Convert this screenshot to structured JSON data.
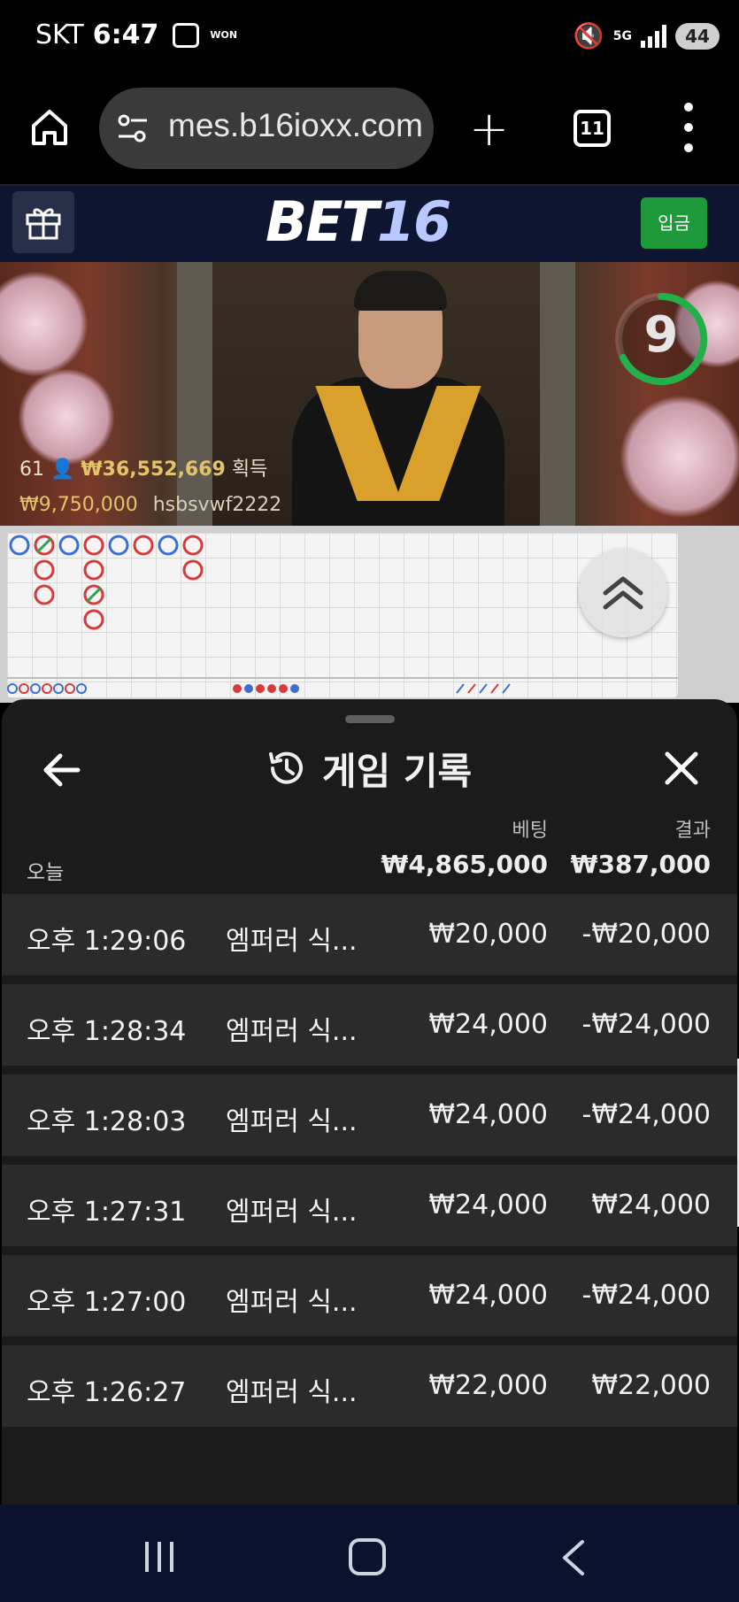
{
  "status_bar": {
    "carrier": "SKT",
    "time": "6:47",
    "won_label": "WON",
    "network": "5G",
    "battery": "44"
  },
  "browser": {
    "url": "mes.b16ioxx.com",
    "tab_count": "11"
  },
  "site": {
    "logo_part1": "BET",
    "logo_part2": "16",
    "deposit_label": "입금"
  },
  "video": {
    "countdown": "9",
    "players": "61",
    "total_win": "₩36,552,669",
    "total_win_suffix": "획득",
    "recent_win_amount": "₩9,750,000",
    "recent_win_user": "hsbsvwf2222"
  },
  "predictions": [
    {
      "label": "P",
      "color": "#3b6fd1"
    },
    {
      "label": "B",
      "color": "#d63a3a"
    },
    {
      "label": "T",
      "color": "#2e9e4f"
    },
    {
      "label": "B",
      "color": "#d63a3a"
    }
  ],
  "history": {
    "title": "게임 기록",
    "col_bet": "베팅",
    "col_result": "결과",
    "summary_label": "오늘",
    "summary_bet": "₩4,865,000",
    "summary_result": "₩387,000",
    "rows": [
      {
        "time": "오후 1:29:06",
        "game": "엠퍼러 식...",
        "bet": "₩20,000",
        "result": "-₩20,000"
      },
      {
        "time": "오후 1:28:34",
        "game": "엠퍼러 식...",
        "bet": "₩24,000",
        "result": "-₩24,000"
      },
      {
        "time": "오후 1:28:03",
        "game": "엠퍼러 식...",
        "bet": "₩24,000",
        "result": "-₩24,000"
      },
      {
        "time": "오후 1:27:31",
        "game": "엠퍼러 식...",
        "bet": "₩24,000",
        "result": "₩24,000"
      },
      {
        "time": "오후 1:27:00",
        "game": "엠퍼러 식...",
        "bet": "₩24,000",
        "result": "-₩24,000"
      },
      {
        "time": "오후 1:26:27",
        "game": "엠퍼러 식...",
        "bet": "₩22,000",
        "result": "₩22,000"
      }
    ]
  },
  "colors": {
    "site_header": "#0d1530",
    "deposit_green": "#1f9a3a",
    "sheet_bg": "#1b1b1b",
    "row_bg": "#2b2b2b",
    "player_blue": "#3b6fd1",
    "banker_red": "#d63a3a",
    "tie_green": "#2e9e4f",
    "nav_bg": "#0a1230"
  },
  "icons": {
    "home": "home-icon",
    "url_settings": "tune-icon",
    "new_tab": "plus-icon",
    "tabs": "tabs-icon",
    "menu": "more-vert-icon",
    "gift": "gift-icon",
    "scroll_up": "double-chevron-up-icon",
    "back": "arrow-left-icon",
    "history": "history-icon",
    "close": "close-icon"
  }
}
